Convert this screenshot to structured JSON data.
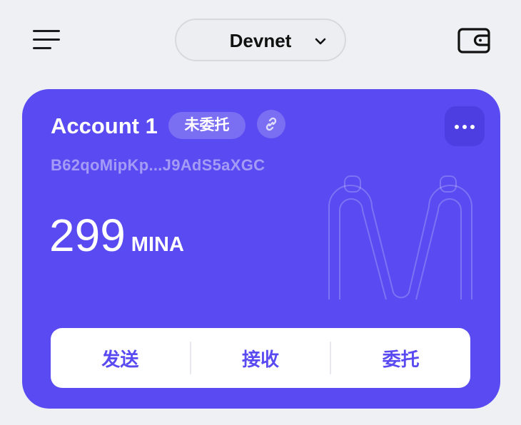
{
  "header": {
    "network": "Devnet"
  },
  "colors": {
    "background": "#eef0f3",
    "card": "#594af1",
    "accent": "#594af1"
  },
  "icons": {
    "menu": "hamburger-menu-icon",
    "network_dropdown": "chevron-down-icon",
    "wallet": "wallet-icon",
    "link": "link-icon",
    "more": "more-horizontal-icon"
  },
  "account": {
    "name": "Account 1",
    "status": "未委托",
    "address": "B62qoMipKp...J9AdS5aXGC",
    "balance": "299",
    "unit": "MINA"
  },
  "actions": {
    "send": "发送",
    "receive": "接收",
    "delegate": "委托"
  }
}
